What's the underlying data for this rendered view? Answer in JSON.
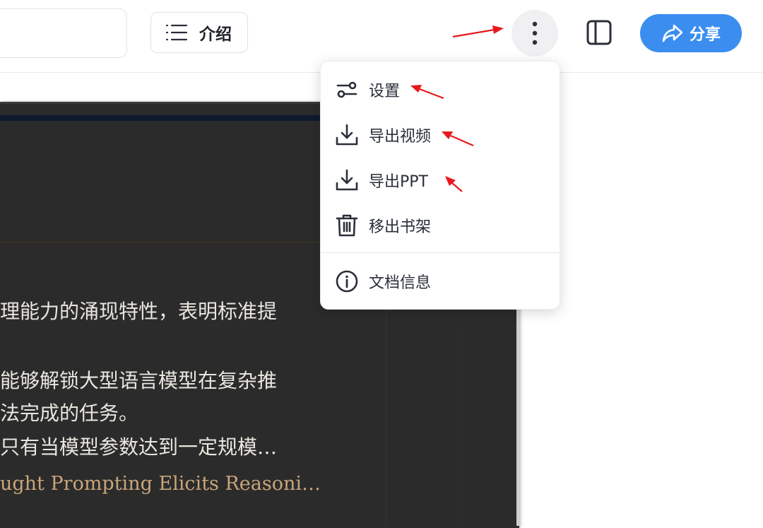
{
  "toolbar": {
    "intro_label": "介绍",
    "share_label": "分享"
  },
  "menu": {
    "items": [
      {
        "label": "设置",
        "icon": "settings-sliders-icon"
      },
      {
        "label": "导出视频",
        "icon": "download-icon"
      },
      {
        "label": "导出PPT",
        "icon": "download-icon"
      },
      {
        "label": "移出书架",
        "icon": "trash-icon"
      },
      {
        "label": "文档信息",
        "icon": "info-icon"
      }
    ]
  },
  "document": {
    "lines": [
      "理能力的涌现特性，表明标准提",
      "能够解锁大型语言模型在复杂推",
      "法完成的任务。",
      "只有当模型参数达到一定规模…",
      "ught Prompting Elicits Reasoni…"
    ]
  },
  "colors": {
    "accent": "#3b8ef0",
    "doc_background": "#2b2b2b",
    "annotation": "#e8191d"
  }
}
